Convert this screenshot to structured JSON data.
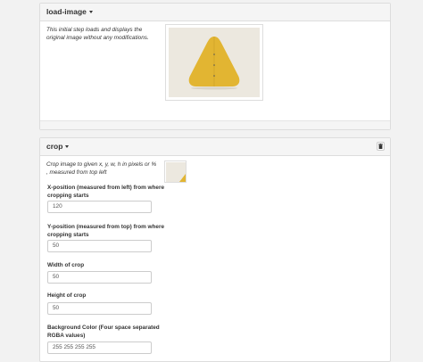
{
  "steps": [
    {
      "title": "load-image",
      "description": "This initial step loads and displays the original image without any modifications."
    },
    {
      "title": "crop",
      "description": "Crop image to given x, y, w, h in pixels or % , measured from top left",
      "fields": [
        {
          "label": "X-position (measured from left) from where cropping starts",
          "value": "120"
        },
        {
          "label": "Y-position (measured from top) from where cropping starts",
          "value": "50"
        },
        {
          "label": "Width of crop",
          "value": "50"
        },
        {
          "label": "Height of crop",
          "value": "50"
        },
        {
          "label": "Background Color (Four space separated RGBA values)",
          "value": "255 255 255 255"
        }
      ]
    }
  ],
  "icons": {
    "dropdown": "caret-down-icon",
    "delete": "trash-icon"
  },
  "colors": {
    "image_yellow": "#e2b532",
    "image_bg": "#ece8df"
  }
}
